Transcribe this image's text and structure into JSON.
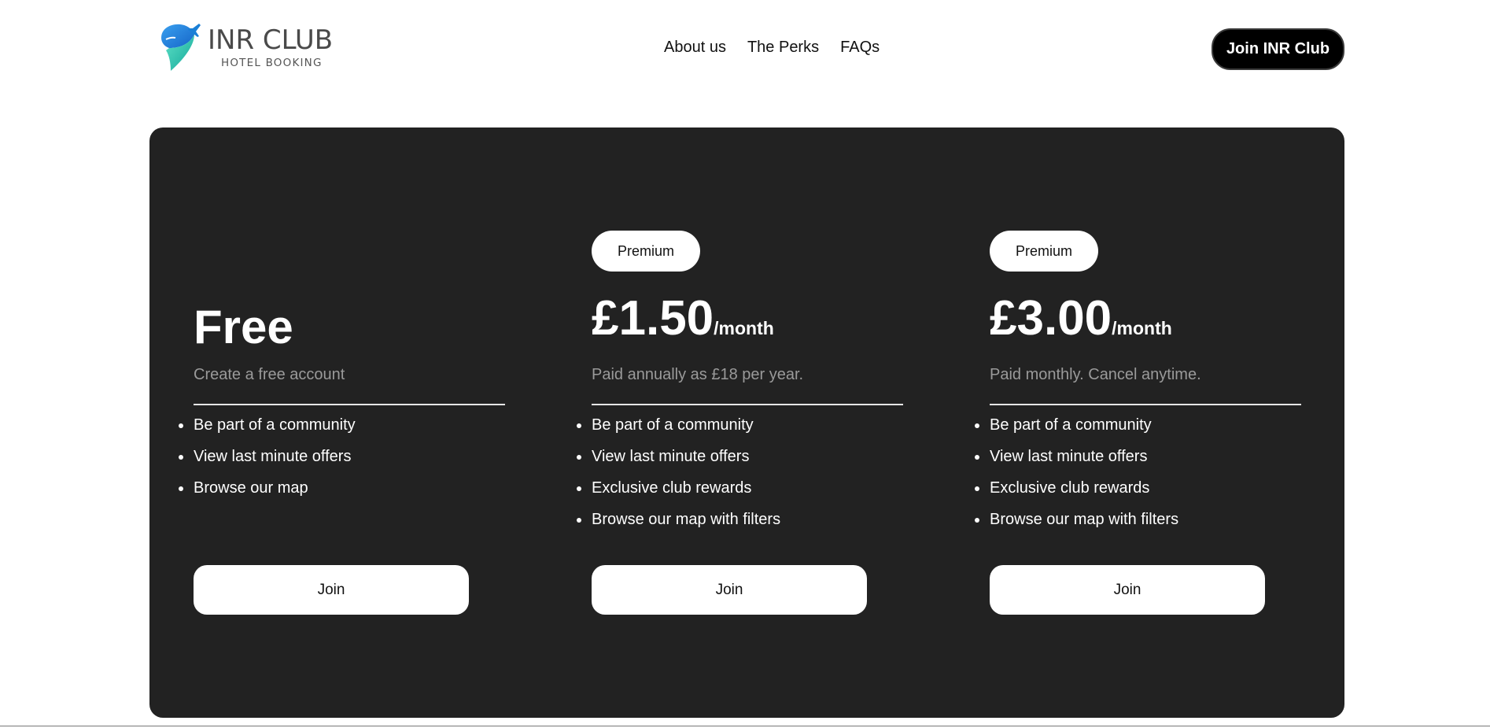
{
  "header": {
    "logo": {
      "title": "INR CLUB",
      "subtitle": "HOTEL BOOKING"
    },
    "nav": [
      {
        "label": "About us"
      },
      {
        "label": "The Perks"
      },
      {
        "label": "FAQs"
      }
    ],
    "cta_label": "Join INR Club"
  },
  "plans": [
    {
      "title": "Free",
      "description": "Create a free account",
      "features": [
        "Be part of a community",
        "View last minute offers",
        "Browse our map"
      ],
      "button_label": "Join"
    },
    {
      "badge": "Premium",
      "price": "£1.50",
      "period": "/month",
      "description": "Paid annually as £18 per year.",
      "features": [
        "Be part of a community",
        "View last minute offers",
        "Exclusive club rewards",
        "Browse our map with filters"
      ],
      "button_label": "Join"
    },
    {
      "badge": "Premium",
      "price": "£3.00",
      "period": "/month",
      "description": "Paid monthly. Cancel anytime.",
      "features": [
        "Be part of a community",
        "View last minute offers",
        "Exclusive club rewards",
        "Browse our map with filters"
      ],
      "button_label": "Join"
    }
  ],
  "colors": {
    "panel_background": "#222222",
    "logo_blue": "#1a7fd6",
    "logo_teal": "#2ec4b0",
    "cta_background": "#000000"
  },
  "icons": {
    "logo_mark": "map-pin-plane-logo-icon"
  }
}
